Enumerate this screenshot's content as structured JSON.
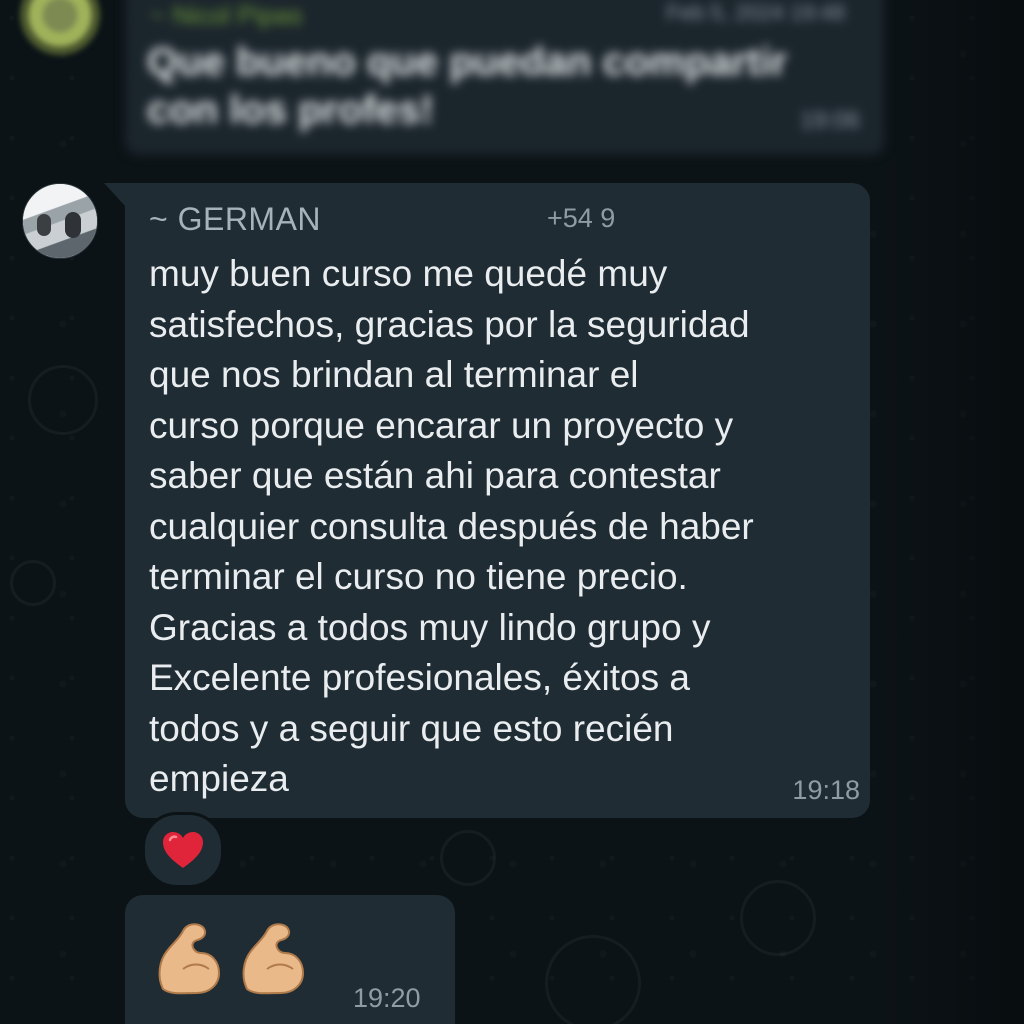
{
  "previous_message": {
    "sender": "~ Nicol Pipas",
    "date": "Feb 5, 2024 19:48",
    "text": "Que bueno que puedan compartir con los profes!",
    "time": "19:06"
  },
  "message": {
    "sender": "~ GERMAN",
    "phone": "+54 9",
    "text": "muy buen curso me quedé muy\nsatisfechos, gracias por la seguridad\nque nos brindan al terminar el\ncurso porque encarar un proyecto y\nsaber que están ahi para contestar\ncualquier consulta después de haber\nterminar el curso no tiene precio.\nGracias a todos muy lindo grupo y\nExcelente profesionales, éxitos a\ntodos y  a seguir que esto recién\nempieza",
    "time": "19:18",
    "reaction": "heart-icon"
  },
  "emoji_message": {
    "icons": [
      "flexed-biceps-icon",
      "flexed-biceps-icon"
    ],
    "time": "19:20"
  },
  "colors": {
    "background": "#0c1317",
    "bubble": "#1f2c33",
    "text": "#e9edef",
    "meta": "#8f9ca3",
    "sender": "#a6b3ba",
    "heart": "#e0243a",
    "skin": "#e9b98a"
  }
}
